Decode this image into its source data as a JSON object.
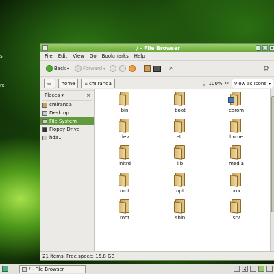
{
  "desktop": {
    "fragments": [
      "s",
      "rs"
    ]
  },
  "window": {
    "title": "/ - File Browser",
    "menu": [
      "File",
      "Edit",
      "View",
      "Go",
      "Bookmarks",
      "Help"
    ],
    "toolbar": {
      "back_label": "Back",
      "forward_label": "Forward"
    },
    "location": {
      "path": [
        "home",
        "cmiranda"
      ],
      "zoom": "100%",
      "view_mode": "View as Icons"
    },
    "sidebar": {
      "header": "Places",
      "items": [
        {
          "label": "cmiranda",
          "icon": "home-icon"
        },
        {
          "label": "Desktop",
          "icon": "desktop-icon"
        },
        {
          "label": "File System",
          "icon": "drive-icon",
          "selected": true
        },
        {
          "label": "Floppy Drive",
          "icon": "floppy-icon"
        },
        {
          "label": "hda1",
          "icon": "drive-icon"
        }
      ]
    },
    "items": [
      "bin",
      "boot",
      "cdrom",
      "dev",
      "etc",
      "home",
      "initrd",
      "lib",
      "media",
      "mnt",
      "opt",
      "proc",
      "root",
      "sbin",
      "srv"
    ],
    "status": "21 items, Free space: 15.8 GB"
  },
  "taskbar": {
    "window_button": "/ - File Browser"
  }
}
